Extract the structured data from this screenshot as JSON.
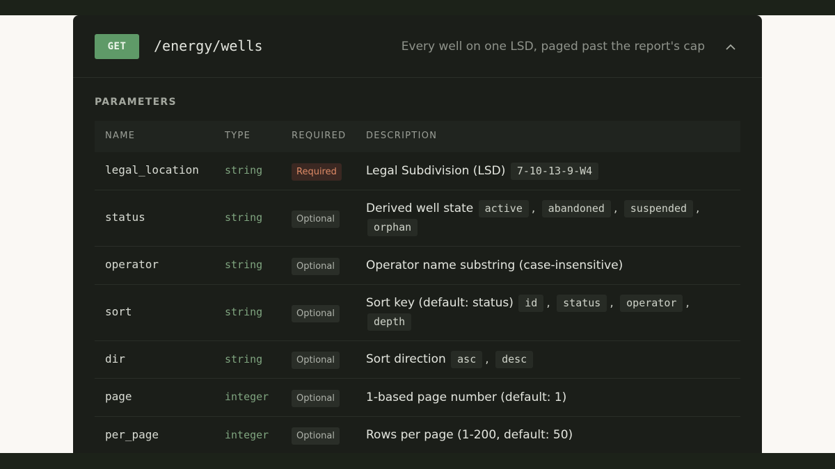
{
  "endpoint": {
    "method": "GET",
    "path": "/energy/wells",
    "summary": "Every well on one LSD, paged past the report's cap",
    "collapse_icon": "chevron-up-icon"
  },
  "parameters": {
    "section_title": "PARAMETERS",
    "columns": {
      "name": "NAME",
      "type": "TYPE",
      "required": "REQUIRED",
      "description": "DESCRIPTION"
    },
    "rows": [
      {
        "name": "legal_location",
        "type": "string",
        "required_label": "Required",
        "required": true,
        "description": "Legal Subdivision (LSD)",
        "examples": [
          "7-10-13-9-W4"
        ]
      },
      {
        "name": "status",
        "type": "string",
        "required_label": "Optional",
        "required": false,
        "description": "Derived well state",
        "examples": [
          "active",
          "abandoned",
          "suspended",
          "orphan"
        ]
      },
      {
        "name": "operator",
        "type": "string",
        "required_label": "Optional",
        "required": false,
        "description": "Operator name substring (case-insensitive)",
        "examples": []
      },
      {
        "name": "sort",
        "type": "string",
        "required_label": "Optional",
        "required": false,
        "description": "Sort key (default: status)",
        "examples": [
          "id",
          "status",
          "operator",
          "depth"
        ]
      },
      {
        "name": "dir",
        "type": "string",
        "required_label": "Optional",
        "required": false,
        "description": "Sort direction",
        "examples": [
          "asc",
          "desc"
        ]
      },
      {
        "name": "page",
        "type": "integer",
        "required_label": "Optional",
        "required": false,
        "description": "1-based page number (default: 1)",
        "examples": []
      },
      {
        "name": "per_page",
        "type": "integer",
        "required_label": "Optional",
        "required": false,
        "description": "Rows per page (1-200, default: 50)",
        "examples": []
      }
    ]
  },
  "colors": {
    "method_badge": "#5f9a68",
    "required_badge_text": "#de8a66",
    "type_text": "#7fa47f",
    "card_background": "#1b1e19"
  }
}
